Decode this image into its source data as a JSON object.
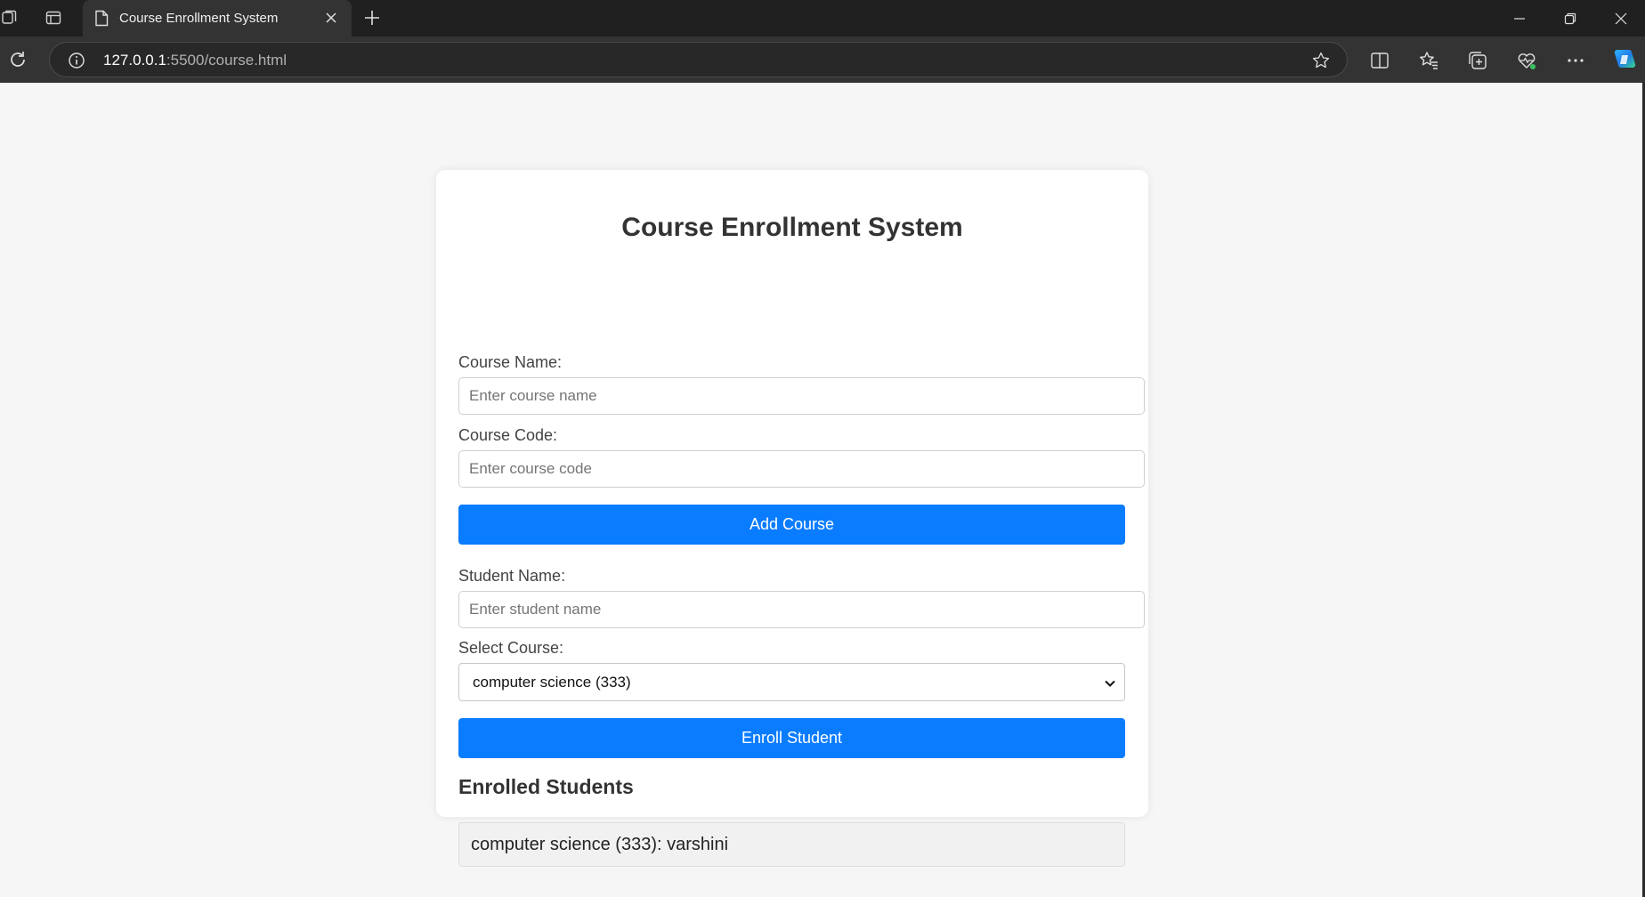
{
  "browser": {
    "tab_title": "Course Enrollment System",
    "url_host": "127.0.0.1",
    "url_rest": ":5500/course.html"
  },
  "page": {
    "title": "Course Enrollment System",
    "course_name_label": "Course Name:",
    "course_name_placeholder": "Enter course name",
    "course_code_label": "Course Code:",
    "course_code_placeholder": "Enter course code",
    "add_course_button": "Add Course",
    "student_name_label": "Student Name:",
    "student_name_placeholder": "Enter student name",
    "select_course_label": "Select Course:",
    "selected_course": "computer science (333)",
    "enroll_button": "Enroll Student",
    "enrolled_heading": "Enrolled Students",
    "enrolled_list": [
      "computer science (333): varshini"
    ]
  },
  "colors": {
    "primary_button": "#0a7cff",
    "browser_frame": "#202020"
  }
}
